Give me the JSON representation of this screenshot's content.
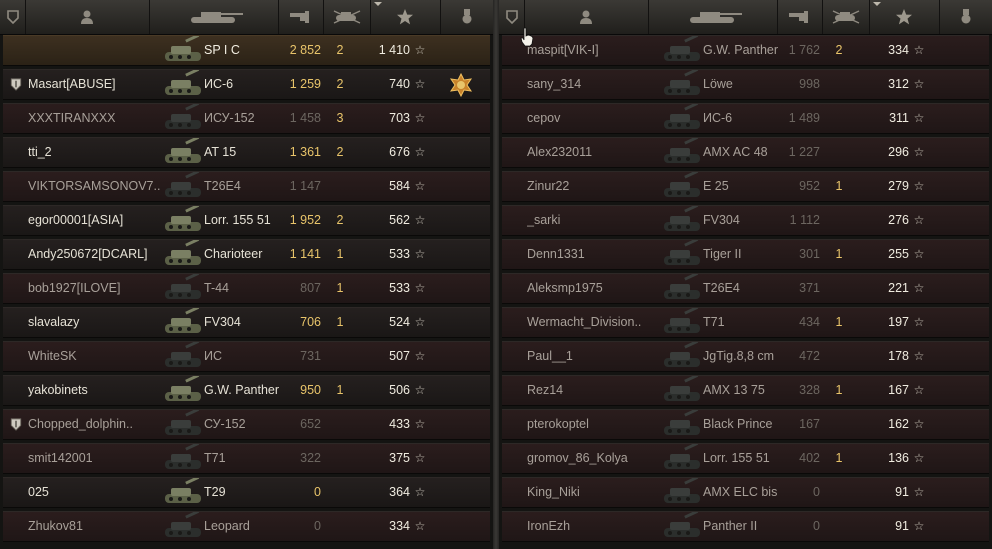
{
  "colors": {
    "damage": "#e8c46a",
    "alive_text": "#e6e2d6",
    "dead_text": "#a8a099",
    "header": "#3b3935"
  },
  "header_icons": [
    "clan-icon",
    "player-icon",
    "tank-icon",
    "damage-icon",
    "kills-icon",
    "xp-star-icon",
    "medal-icon"
  ],
  "left_team": [
    {
      "name": "",
      "tank": "SP I C",
      "damage": "2 852",
      "kills": "2",
      "xp": "1 410",
      "alive": true,
      "player": true
    },
    {
      "name": "Masart[ABUSE]",
      "tank": "ИС-6",
      "damage": "1 259",
      "kills": "2",
      "xp": "740",
      "alive": true,
      "clan": true,
      "medal": true
    },
    {
      "name": "XXXTIRANXXX",
      "tank": "ИСУ-152",
      "damage": "1 458",
      "kills": "3",
      "xp": "703",
      "alive": false
    },
    {
      "name": "tti_2",
      "tank": "AT 15",
      "damage": "1 361",
      "kills": "2",
      "xp": "676",
      "alive": true
    },
    {
      "name": "VIKTORSAMSONOV7..",
      "tank": "T26E4",
      "damage": "1 147",
      "kills": "",
      "xp": "584",
      "alive": false
    },
    {
      "name": "egor00001[ASIA]",
      "tank": "Lorr. 155 51",
      "damage": "1 952",
      "kills": "2",
      "xp": "562",
      "alive": true
    },
    {
      "name": "Andy250672[DCARL]",
      "tank": "Charioteer",
      "damage": "1 141",
      "kills": "1",
      "xp": "533",
      "alive": true
    },
    {
      "name": "bob1927[ILOVE]",
      "tank": "T-44",
      "damage": "807",
      "kills": "1",
      "xp": "533",
      "alive": false
    },
    {
      "name": "slavalazy",
      "tank": "FV304",
      "damage": "706",
      "kills": "1",
      "xp": "524",
      "alive": true
    },
    {
      "name": "WhiteSK",
      "tank": "ИС",
      "damage": "731",
      "kills": "",
      "xp": "507",
      "alive": false
    },
    {
      "name": "yakobinets",
      "tank": "G.W. Panther",
      "damage": "950",
      "kills": "1",
      "xp": "506",
      "alive": true
    },
    {
      "name": "Chopped_dolphin..",
      "tank": "СУ-152",
      "damage": "652",
      "kills": "",
      "xp": "433",
      "alive": false,
      "clan": true
    },
    {
      "name": "smit142001",
      "tank": "T71",
      "damage": "322",
      "kills": "",
      "xp": "375",
      "alive": false
    },
    {
      "name": "025",
      "tank": "T29",
      "damage": "0",
      "kills": "",
      "xp": "364",
      "alive": true
    },
    {
      "name": "Zhukov81",
      "tank": "Leopard",
      "damage": "0",
      "kills": "",
      "xp": "334",
      "alive": false
    }
  ],
  "right_team": [
    {
      "name": "maspit[VIK-I]",
      "tank": "G.W. Panther",
      "damage": "1 762",
      "kills": "2",
      "xp": "334",
      "alive": false
    },
    {
      "name": "sany_314",
      "tank": "Löwe",
      "damage": "998",
      "kills": "",
      "xp": "312",
      "alive": false
    },
    {
      "name": "cepov",
      "tank": "ИС-6",
      "damage": "1 489",
      "kills": "",
      "xp": "311",
      "alive": false
    },
    {
      "name": "Alex232011",
      "tank": "AMX AC 48",
      "damage": "1 227",
      "kills": "",
      "xp": "296",
      "alive": false
    },
    {
      "name": "Zinur22",
      "tank": "E 25",
      "damage": "952",
      "kills": "1",
      "xp": "279",
      "alive": false
    },
    {
      "name": "_sarki",
      "tank": "FV304",
      "damage": "1 112",
      "kills": "",
      "xp": "276",
      "alive": false
    },
    {
      "name": "Denn1331",
      "tank": "Tiger II",
      "damage": "301",
      "kills": "1",
      "xp": "255",
      "alive": false
    },
    {
      "name": "Aleksmp1975",
      "tank": "T26E4",
      "damage": "371",
      "kills": "",
      "xp": "221",
      "alive": false
    },
    {
      "name": "Wermacht_Division..",
      "tank": "T71",
      "damage": "434",
      "kills": "1",
      "xp": "197",
      "alive": false
    },
    {
      "name": "Paul__1",
      "tank": "JgTig.8,8 cm",
      "damage": "472",
      "kills": "",
      "xp": "178",
      "alive": false
    },
    {
      "name": "Rez14",
      "tank": "AMX 13 75",
      "damage": "328",
      "kills": "1",
      "xp": "167",
      "alive": false
    },
    {
      "name": "pterokoptel",
      "tank": "Black Prince",
      "damage": "167",
      "kills": "",
      "xp": "162",
      "alive": false
    },
    {
      "name": "gromov_86_Kolya",
      "tank": "Lorr. 155 51",
      "damage": "402",
      "kills": "1",
      "xp": "136",
      "alive": false
    },
    {
      "name": "King_Niki",
      "tank": "AMX ELC bis",
      "damage": "0",
      "kills": "",
      "xp": "91",
      "alive": false
    },
    {
      "name": "IronEzh",
      "tank": "Panther II",
      "damage": "0",
      "kills": "",
      "xp": "91",
      "alive": false
    }
  ],
  "star_glyph": "☆"
}
